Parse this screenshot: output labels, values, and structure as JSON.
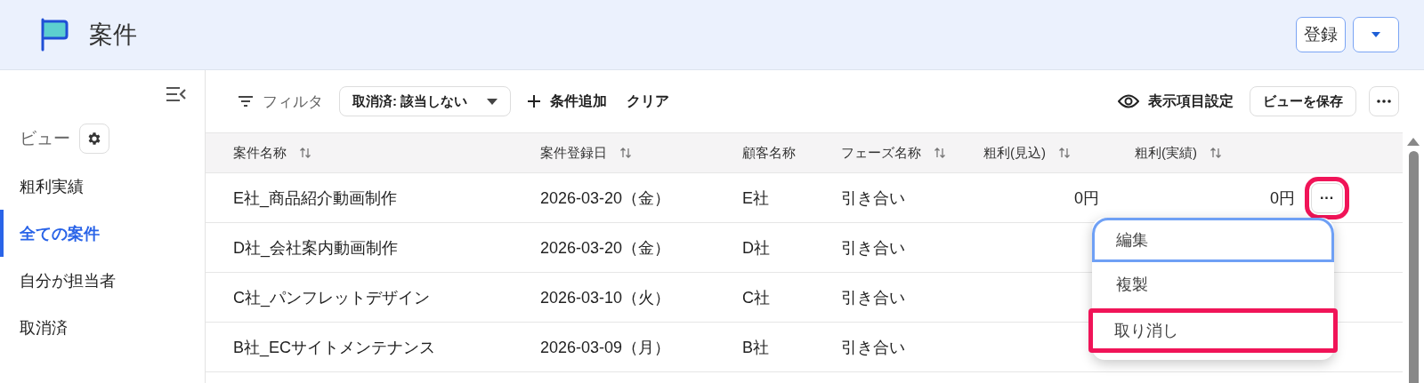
{
  "header": {
    "title": "案件",
    "register_button": "登録"
  },
  "sidebar": {
    "heading": "ビュー",
    "items": [
      {
        "label": "粗利実績",
        "selected": false
      },
      {
        "label": "全ての案件",
        "selected": true
      },
      {
        "label": "自分が担当者",
        "selected": false
      },
      {
        "label": "取消済",
        "selected": false
      }
    ]
  },
  "toolbar": {
    "filter_label": "フィルタ",
    "filter_chip": "取消済: 該当しない",
    "add_condition": "条件追加",
    "clear": "クリア",
    "columns_setting": "表示項目設定",
    "save_view": "ビューを保存"
  },
  "table": {
    "columns": [
      {
        "label": "案件名称",
        "sortable": true,
        "kind": "text"
      },
      {
        "label": "案件登録日",
        "sortable": true,
        "kind": "text"
      },
      {
        "label": "顧客名称",
        "sortable": false,
        "kind": "text"
      },
      {
        "label": "フェーズ名称",
        "sortable": true,
        "kind": "text"
      },
      {
        "label": "粗利(見込)",
        "sortable": true,
        "kind": "amount"
      },
      {
        "label": "粗利(実績)",
        "sortable": true,
        "kind": "amount"
      }
    ],
    "rows": [
      {
        "cells": [
          "E社_商品紹介動画制作",
          "2026-03-20（金）",
          "E社",
          "引き合い",
          "0円",
          "0円"
        ],
        "action": {
          "label": "···",
          "highlighted": true
        }
      },
      {
        "cells": [
          "D社_会社案内動画制作",
          "2026-03-20（金）",
          "D社",
          "引き合い"
        ]
      },
      {
        "cells": [
          "C社_パンフレットデザイン",
          "2026-03-10（火）",
          "C社",
          "引き合い"
        ]
      },
      {
        "cells": [
          "B社_ECサイトメンテナンス",
          "2026-03-09（月）",
          "B社",
          "引き合い"
        ]
      }
    ]
  },
  "row_menu": {
    "items": [
      {
        "label": "編集",
        "focused": true,
        "highlighted": false
      },
      {
        "label": "複製",
        "focused": false,
        "highlighted": false
      },
      {
        "label": "取り消し",
        "focused": false,
        "highlighted": true
      }
    ]
  }
}
